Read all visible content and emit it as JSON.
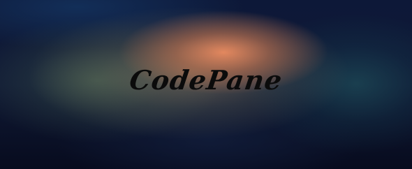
{
  "banner": {
    "title": "CodePane"
  },
  "colors": {
    "background_dark": "#0a0f24",
    "glow_orange": "#ec8c60",
    "glow_green": "#486250",
    "glow_teal": "#1e4e5a",
    "title_text": "#0b0b0b"
  }
}
